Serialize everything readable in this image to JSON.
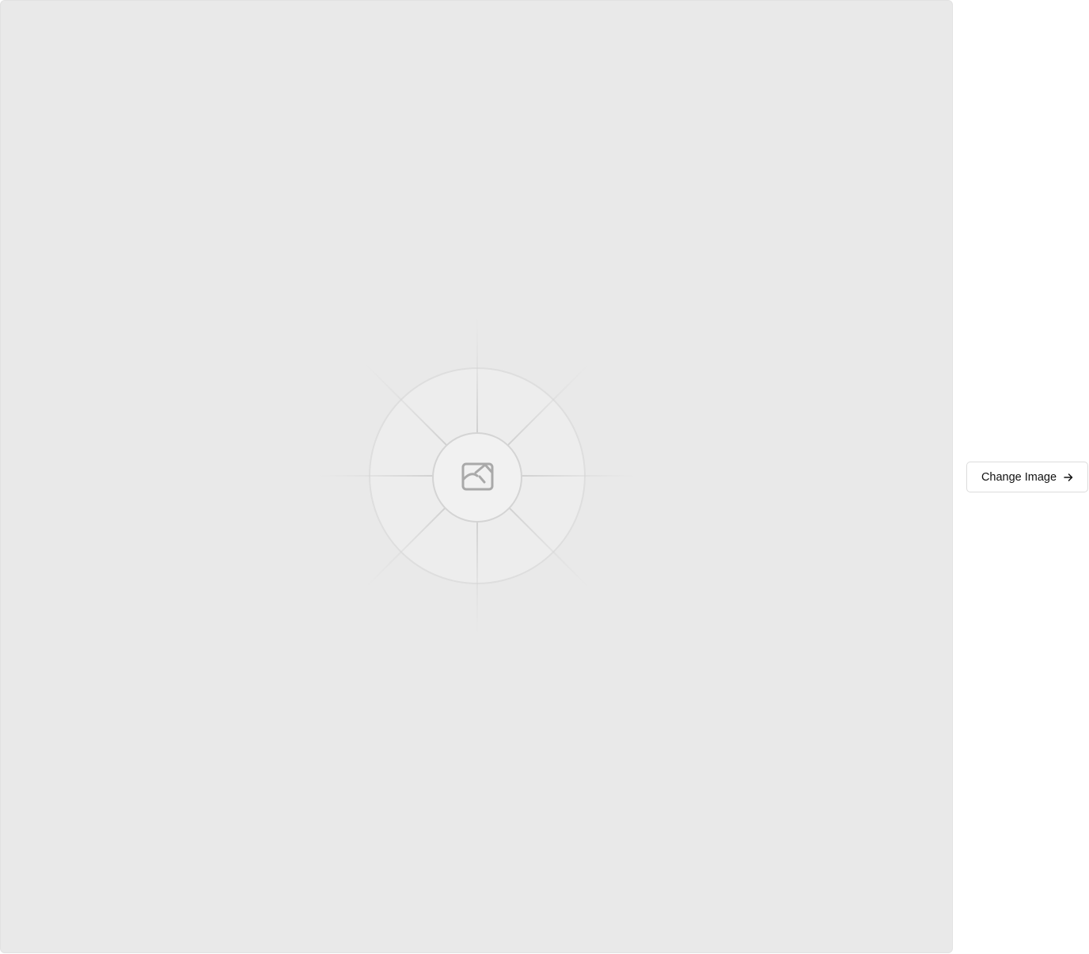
{
  "image_panel": {
    "placeholder_icon": "image-placeholder-icon",
    "background_color": "#e9e9e9"
  },
  "actions": {
    "change_image_label": "Change Image",
    "change_image_icon": "arrow-right-icon"
  }
}
